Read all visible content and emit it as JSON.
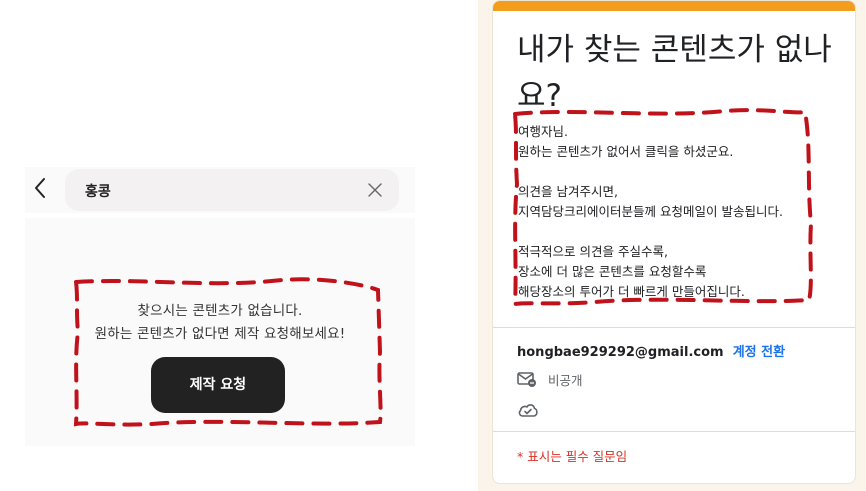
{
  "search_screen": {
    "query": "홍콩",
    "empty_message_line1": "찾으시는 콘텐츠가 없습니다.",
    "empty_message_line2": "원하는 콘텐츠가 없다면 제작 요청해보세요!",
    "request_button_label": "제작 요청"
  },
  "form": {
    "accent_color": "#f29d1e",
    "title": "내가 찾는 콘텐츠가 없나요?",
    "description": [
      "여행자님.",
      "원하는 콘텐츠가 없어서 클릭을 하셨군요.",
      "",
      "의견을 남겨주시면,",
      "지역담당크리에이터분들께 요청메일이 발송됩니다.",
      "",
      "적극적으로 의견을 주실수록,",
      "장소에 더 많은 콘텐츠를 요청할수록",
      "해당장소의 투어가 더 빠르게 만들어집니다."
    ],
    "account_email": "hongbae929292@gmail.com",
    "switch_account_label": "계정 전환",
    "privacy_label": "비공개",
    "required_note": "* 표시는 필수 질문임"
  },
  "annotation_color": "#c0121a"
}
